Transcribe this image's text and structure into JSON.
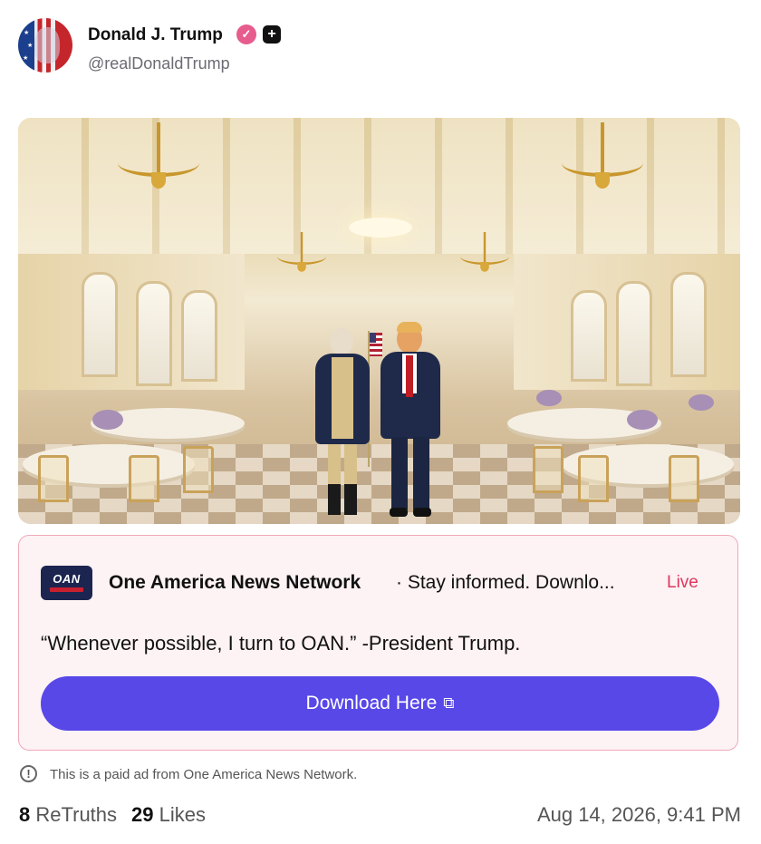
{
  "author": {
    "display_name": "Donald J. Trump",
    "handle": "@realDonaldTrump",
    "verified_icon": "verified-badge-icon",
    "extra_badge_icon": "plus-badge-icon"
  },
  "ad": {
    "source_name": "One America News Network",
    "tagline": "· Stay informed. Downlo...",
    "live_label": "Live",
    "logo_text": "OAN",
    "quote": "“Whenever possible, I turn to OAN.” -President Trump.",
    "button_label": "Download Here",
    "button_icon": "external-link-icon",
    "colors": {
      "accent": "#5848e8",
      "live": "#e0365e",
      "card_border": "#f0a9b8",
      "card_bg": "#fdf2f4"
    }
  },
  "disclaimer": "This is a paid ad from One America News Network.",
  "stats": {
    "retruths_count": "8",
    "retruths_label": "ReTruths",
    "likes_count": "29",
    "likes_label": "Likes"
  },
  "timestamp": "Aug 14, 2026, 9:41 PM"
}
